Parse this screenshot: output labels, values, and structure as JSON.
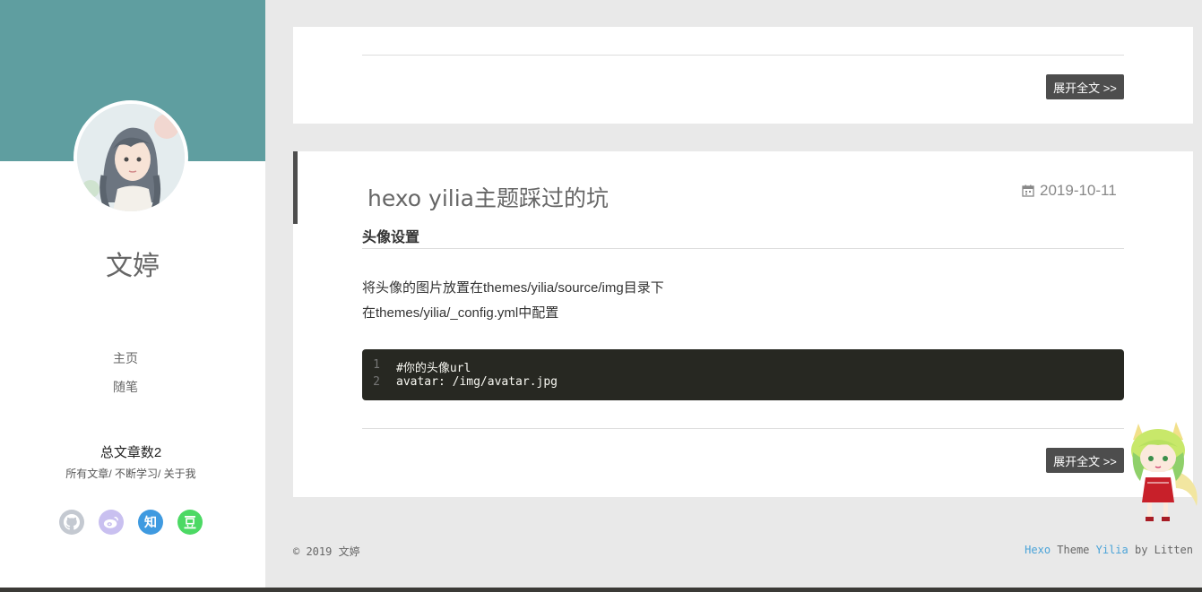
{
  "sidebar": {
    "author_name": "文婷",
    "nav": [
      {
        "label": "主页"
      },
      {
        "label": "随笔"
      }
    ],
    "total_posts": "总文章数2",
    "links": [
      "所有文章",
      "不断学习",
      "关于我"
    ],
    "link_separator": "/ ",
    "social": [
      {
        "icon": "github-icon",
        "glyph": "",
        "color": "#c4c9d1"
      },
      {
        "icon": "weibo-icon",
        "glyph": "",
        "color": "#c9c0f0"
      },
      {
        "icon": "zhihu-icon",
        "glyph": "知",
        "color": "#3f9ae0"
      },
      {
        "icon": "douban-icon",
        "glyph": "",
        "color": "#4cd964"
      }
    ],
    "banner_color": "#5f9ea0"
  },
  "posts": [
    {
      "more_label": "展开全文 >>"
    },
    {
      "title": "hexo yilia主题踩过的坑",
      "date": "2019-10-11",
      "heading": "头像设置",
      "paragraphs": [
        "将头像的图片放置在themes/yilia/source/img目录下",
        "在themes/yilia/_config.yml中配置"
      ],
      "code": [
        {
          "ln": "1",
          "text": "#你的头像url"
        },
        {
          "ln": "2",
          "text": "avatar: /img/avatar.jpg"
        }
      ],
      "more_label": "展开全文 >>"
    }
  ],
  "footer": {
    "copyright": "© 2019 文婷",
    "hexo": "Hexo",
    "theme_word": " Theme ",
    "yilia": "Yilia",
    "by": " by Litten"
  }
}
